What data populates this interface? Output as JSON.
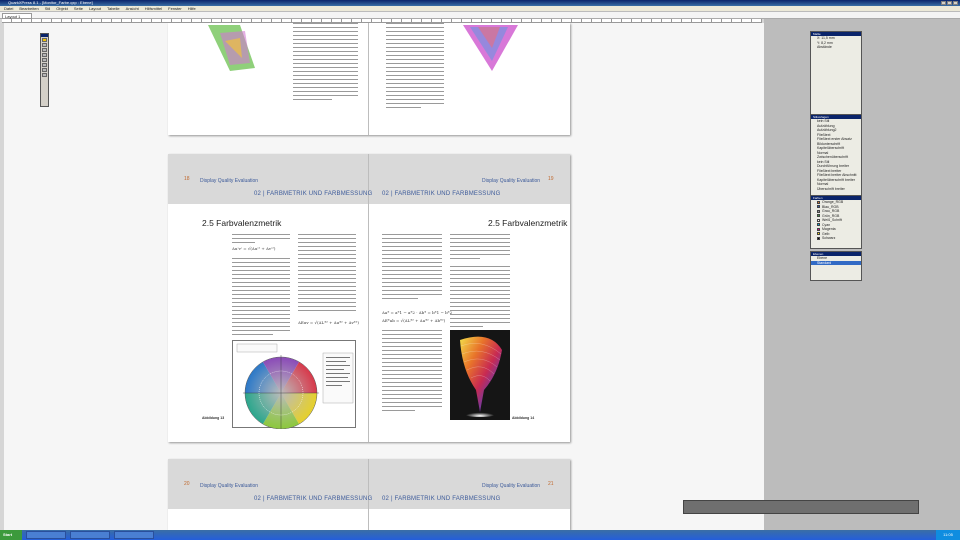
{
  "window": {
    "title": "QuarkXPress 8.1 - [Monitor_Farbe.qxp : Ebene]",
    "menu": [
      "Datei",
      "Bearbeiten",
      "Stil",
      "Objekt",
      "Seite",
      "Layout",
      "Tabelle",
      "Ansicht",
      "Hilfsmittel",
      "Fenster",
      "Hilfe"
    ],
    "doc_tab": "Layout 1"
  },
  "spread": {
    "left_page_number": "18",
    "right_page_number": "19",
    "brand": "Display Quality Evaluation",
    "chapter_left": "02 | FARBMETRIK UND FARBMESSUNG",
    "chapter_right": "02 | FARBMETRIK UND FARBMESSUNG",
    "section_left": "2.5 Farbvalenzmetrik",
    "section_right": "2.5 Farbvalenzmetrik",
    "formula_left_1": "Δu'v' = √(Δu'² + Δv'²)",
    "formula_left_2": "ΔEuv = √(ΔL*² + Δu*² + Δv*²)",
    "formula_right_1": "Δa* = a*1 − a*2 · Δb* = b*1 − b*2",
    "formula_right_2": "ΔE*ab = √(ΔL*² + Δa*² + Δb*²)",
    "caption_left": "Abbildung 13",
    "caption_right": "Abbildung 14"
  },
  "next_spread": {
    "left_page_number": "20",
    "right_page_number": "21",
    "brand": "Display Quality Evaluation",
    "chapter_left": "02 | FARBMETRIK UND FARBMESSUNG",
    "chapter_right": "02 | FARBMETRIK UND FARBMESSUNG"
  },
  "palettes": {
    "measurements": {
      "title": "Maße",
      "items": [
        "X: 11,5 mm",
        "Y: 8,2 mm",
        "Abstände"
      ]
    },
    "styles": {
      "title": "Stilvorlagen",
      "items": [
        "kein Stil",
        "Aufzählung",
        "Aufzählung2",
        "Fließtext",
        "Fließtext erster Absatz",
        "Bildunterschrift",
        "Kapitelüberschrift",
        "Normal",
        "Zwischenüberschrift",
        "kein Stil",
        "Durchführung breiter",
        "Fließtext breiter",
        "Fließtext breiter Abschnitt",
        "Kapitelüberschrift breiter",
        "Normal",
        "Überschrift breiter"
      ]
    },
    "colors": {
      "title": "Farben",
      "items": [
        {
          "name": "Orange_RGB",
          "color": "#e07a2c"
        },
        {
          "name": "Blau_RGB",
          "color": "#2a5ab8"
        },
        {
          "name": "Grau_RGB",
          "color": "#9a9a9a"
        },
        {
          "name": "Grün_RGB",
          "color": "#3ca03c"
        },
        {
          "name": "Weiß_Schrift",
          "color": "#ffffff"
        },
        {
          "name": "Cyan",
          "color": "#00b4e6"
        },
        {
          "name": "Magenta",
          "color": "#e0008c"
        },
        {
          "name": "Gelb",
          "color": "#ffe600"
        },
        {
          "name": "Schwarz",
          "color": "#000000"
        }
      ]
    },
    "layers": {
      "title": "Ebenen",
      "items": [
        "Ebene",
        "Standard"
      ],
      "selected": "Standard"
    }
  },
  "progress": {
    "value": 0.0
  },
  "taskbar": {
    "start": "Start",
    "clock": "11:05"
  },
  "icons": [
    "pointer-tool-icon",
    "content-tool-icon",
    "rotate-tool-icon",
    "zoom-tool-icon",
    "text-box-tool-icon",
    "picture-box-tool-icon",
    "line-tool-icon",
    "pan-tool-icon"
  ]
}
